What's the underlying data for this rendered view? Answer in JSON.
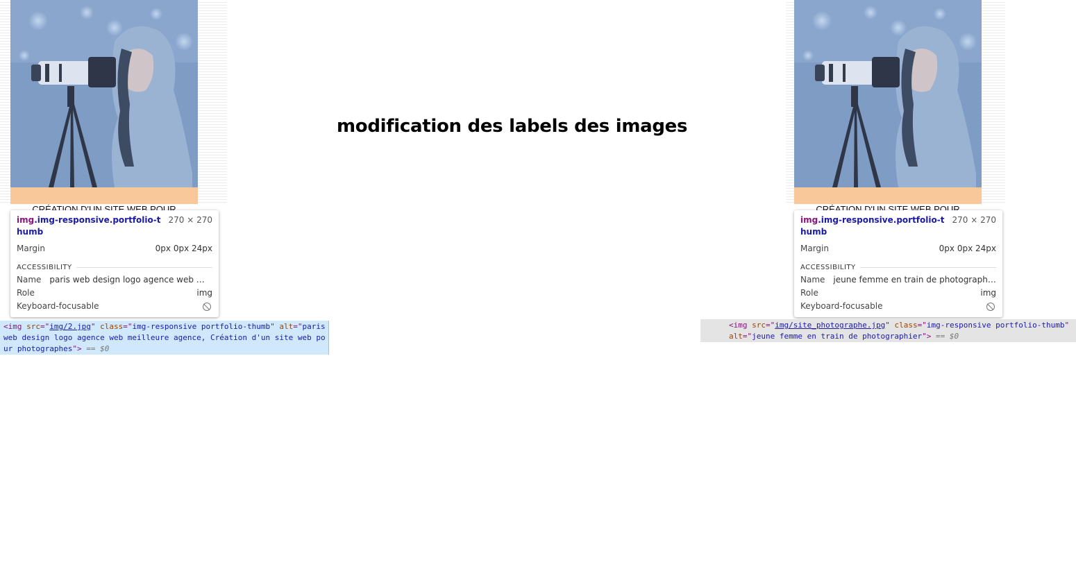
{
  "heading": "modification des labels des images",
  "left": {
    "caption": "CRÉATION D'UN SITE WEB POUR",
    "tooltip": {
      "selector_tag": "img",
      "selector_class": ".img-responsive.portfolio-thumb",
      "size": "270 × 270",
      "margin_label": "Margin",
      "margin_value": "0px 0px 24px",
      "section": "ACCESSIBILITY",
      "name_label": "Name",
      "name_value": "paris web design logo agence web meil...",
      "role_label": "Role",
      "role_value": "img",
      "focus_label": "Keyboard-focusable"
    },
    "code": {
      "open": "<img",
      "src_attr": "src",
      "src_val": "img/2.jpg",
      "class_attr": "class",
      "class_val": "img-responsive portfolio-thumb",
      "alt_attr": "alt",
      "alt_val": "paris web design logo agence web meilleure agence, Création d'un site web pour photographes",
      "close": ">",
      "dollar": " == $0"
    }
  },
  "right": {
    "caption": "CRÉATION D'UN SITE WEB POUR",
    "tooltip": {
      "selector_tag": "img",
      "selector_class": ".img-responsive.portfolio-thumb",
      "size": "270 × 270",
      "margin_label": "Margin",
      "margin_value": "0px 0px 24px",
      "section": "ACCESSIBILITY",
      "name_label": "Name",
      "name_value": "jeune femme en train de photographier",
      "role_label": "Role",
      "role_value": "img",
      "focus_label": "Keyboard-focusable"
    },
    "code": {
      "open": "<img",
      "src_attr": "src",
      "src_val": "img/site_photographe.jpg",
      "class_attr": "class",
      "class_val": "img-responsive portfolio-thumb",
      "alt_attr": "alt",
      "alt_val": "jeune femme en train de photographier",
      "close": ">",
      "dollar": " == $0"
    }
  },
  "icons": {
    "keyboard_focus": "not-allowed-icon"
  }
}
